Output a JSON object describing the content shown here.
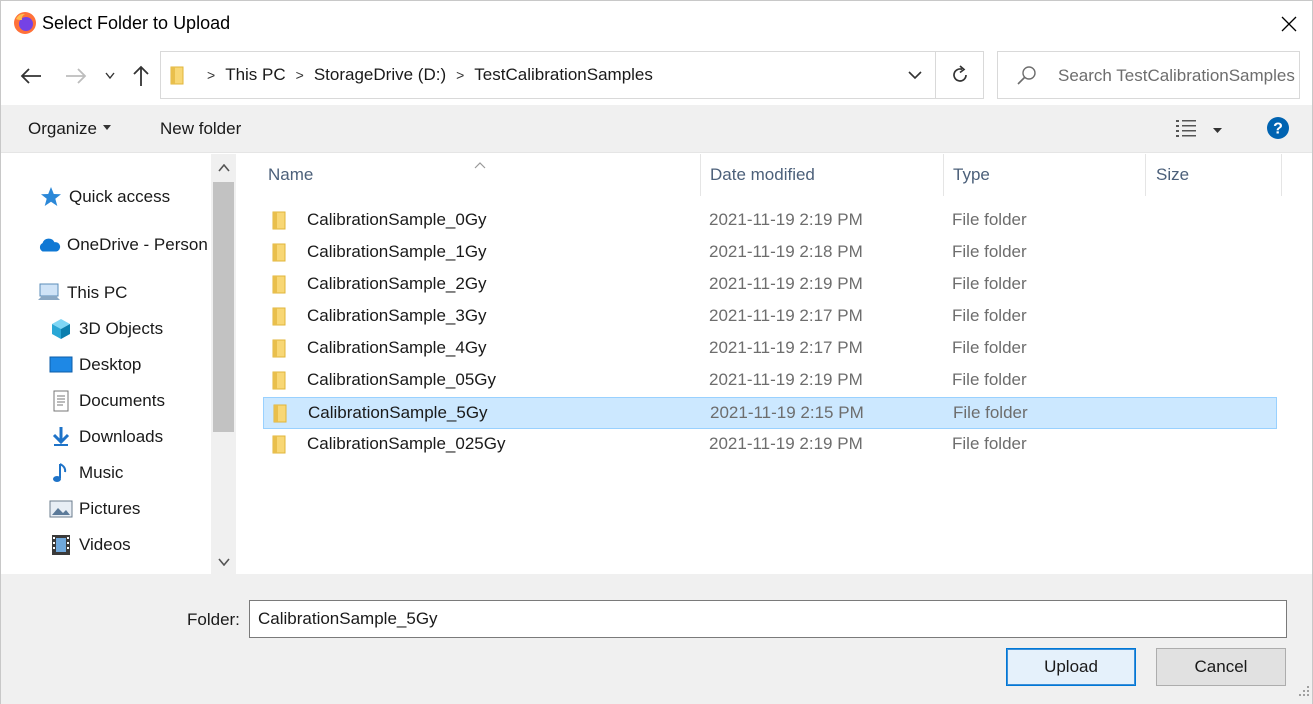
{
  "window": {
    "title": "Select Folder to Upload"
  },
  "address": {
    "crumbs": [
      "This PC",
      "StorageDrive (D:)",
      "TestCalibrationSamples"
    ],
    "separator": ">"
  },
  "search": {
    "placeholder": "Search TestCalibrationSamples"
  },
  "toolbar": {
    "organize_label": "Organize",
    "new_folder_label": "New folder"
  },
  "nav": {
    "items": [
      {
        "label": "Quick access",
        "icon": "star-icon"
      },
      {
        "label": "OneDrive - Person",
        "icon": "cloud-icon"
      },
      {
        "label": "This PC",
        "icon": "computer-icon"
      },
      {
        "label": "3D Objects",
        "icon": "cube-icon"
      },
      {
        "label": "Desktop",
        "icon": "desktop-icon"
      },
      {
        "label": "Documents",
        "icon": "document-icon"
      },
      {
        "label": "Downloads",
        "icon": "download-icon"
      },
      {
        "label": "Music",
        "icon": "music-icon"
      },
      {
        "label": "Pictures",
        "icon": "pictures-icon"
      },
      {
        "label": "Videos",
        "icon": "videos-icon"
      }
    ]
  },
  "columns": {
    "name": "Name",
    "date": "Date modified",
    "type": "Type",
    "size": "Size"
  },
  "files": [
    {
      "name": "CalibrationSample_0Gy",
      "date": "2021-11-19 2:19 PM",
      "type": "File folder"
    },
    {
      "name": "CalibrationSample_1Gy",
      "date": "2021-11-19 2:18 PM",
      "type": "File folder"
    },
    {
      "name": "CalibrationSample_2Gy",
      "date": "2021-11-19 2:19 PM",
      "type": "File folder"
    },
    {
      "name": "CalibrationSample_3Gy",
      "date": "2021-11-19 2:17 PM",
      "type": "File folder"
    },
    {
      "name": "CalibrationSample_4Gy",
      "date": "2021-11-19 2:17 PM",
      "type": "File folder"
    },
    {
      "name": "CalibrationSample_05Gy",
      "date": "2021-11-19 2:19 PM",
      "type": "File folder"
    },
    {
      "name": "CalibrationSample_5Gy",
      "date": "2021-11-19 2:15 PM",
      "type": "File folder",
      "selected": true
    },
    {
      "name": "CalibrationSample_025Gy",
      "date": "2021-11-19 2:19 PM",
      "type": "File folder"
    }
  ],
  "footer": {
    "folder_label": "Folder:",
    "folder_value": "CalibrationSample_5Gy",
    "upload_label": "Upload",
    "cancel_label": "Cancel"
  },
  "colors": {
    "selection": "#cce8ff",
    "accent": "#0078d7",
    "folder": "#f8d775"
  }
}
